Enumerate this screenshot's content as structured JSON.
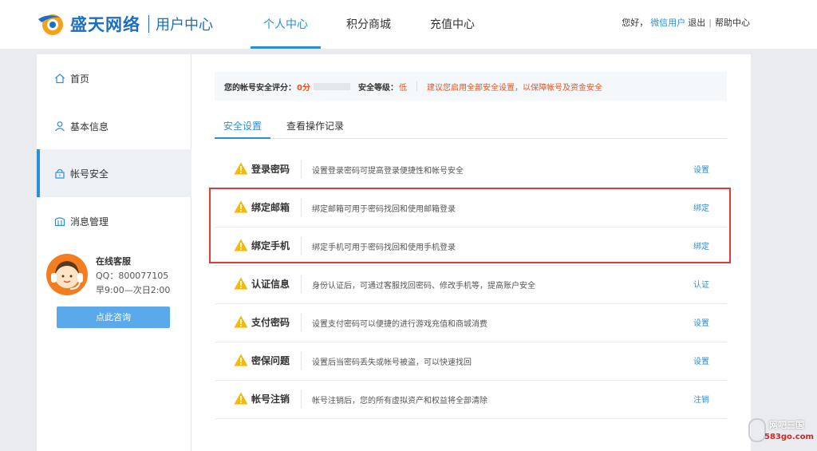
{
  "header": {
    "brand": "盛天网络",
    "subtitle": "用户中心",
    "nav": [
      "个人中心",
      "积分商城",
      "充值中心"
    ],
    "greeting": "您好，",
    "username": "微信用户",
    "logout": "退出",
    "separator": "|",
    "help": "帮助中心"
  },
  "sidebar": {
    "items": [
      {
        "label": "首页",
        "icon": "home-icon"
      },
      {
        "label": "基本信息",
        "icon": "user-icon"
      },
      {
        "label": "帐号安全",
        "icon": "lock-icon",
        "active": true
      },
      {
        "label": "消息管理",
        "icon": "message-icon"
      }
    ],
    "service": {
      "title": "在线客服",
      "qq": "QQ：800077105",
      "hours": "早9:00—次日2:00",
      "button": "点此咨询"
    }
  },
  "security": {
    "score_label": "您的帐号安全评分：",
    "score_value": "0分",
    "score_fraction": 0,
    "level_label": "安全等级：",
    "level_value": "低",
    "advice": "建议您启用全部安全设置，以保障帐号及资金安全"
  },
  "tabs": [
    "安全设置",
    "查看操作记录"
  ],
  "rows": [
    {
      "name": "登录密码",
      "desc": "设置登录密码可提高登录便捷性和帐号安全",
      "action": "设置"
    },
    {
      "name": "绑定邮箱",
      "desc": "绑定邮箱可用于密码找回和使用邮箱登录",
      "action": "绑定"
    },
    {
      "name": "绑定手机",
      "desc": "绑定手机可用于密码找回和使用手机登录",
      "action": "绑定"
    },
    {
      "name": "认证信息",
      "desc": "身份认证后，可通过客服找回密码、修改手机等，提高账户安全",
      "action": "认证"
    },
    {
      "name": "支付密码",
      "desc": "设置支付密码可以便捷的进行游戏充值和商城消费",
      "action": "设置"
    },
    {
      "name": "密保问题",
      "desc": "设置后当密码丢失或帐号被盗，可以快速找回",
      "action": "设置"
    },
    {
      "name": "帐号注销",
      "desc": "帐号注销后，您的所有虚拟资产和权益将全部清除",
      "action": "注销"
    }
  ],
  "watermark": {
    "text1": "网吧三国",
    "text2": "583go.com"
  },
  "colors": {
    "accent": "#2b8fd8",
    "warning": "#e5531b",
    "highlight_border": "#e03a3a"
  }
}
